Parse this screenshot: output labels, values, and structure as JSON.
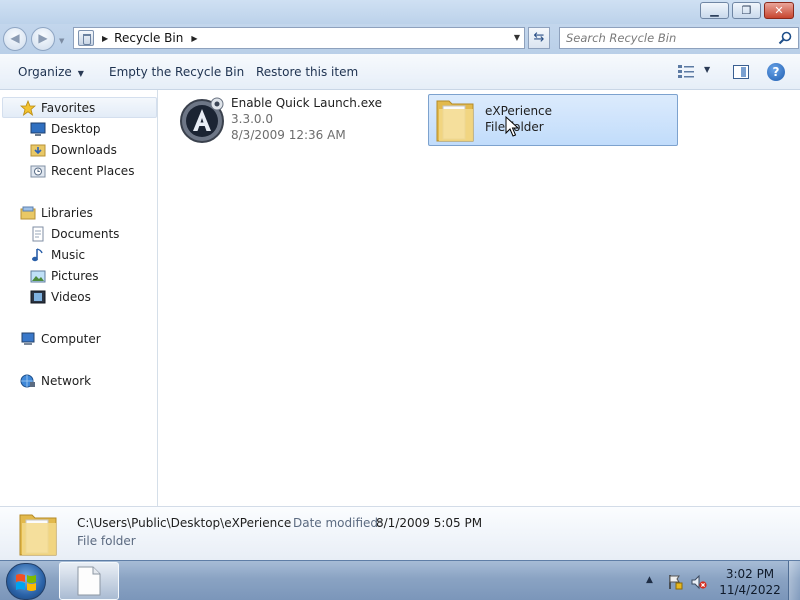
{
  "window": {
    "controls": {
      "minimize": "▁",
      "maximize": "❐",
      "close": "✕"
    }
  },
  "address": {
    "back": "◀",
    "forward": "▶",
    "crumb_sep": "▶",
    "crumb": "Recycle Bin",
    "trail_sep": "▶",
    "dropdown": "▼",
    "refresh": "⇆",
    "search_placeholder": "Search Recycle Bin"
  },
  "toolbar": {
    "organize": "Organize",
    "organize_dd": "▼",
    "empty": "Empty the Recycle Bin",
    "restore": "Restore this item",
    "view_dd": "▼",
    "help": "?"
  },
  "nav": {
    "favorites": {
      "label": "Favorites",
      "items": [
        "Desktop",
        "Downloads",
        "Recent Places"
      ]
    },
    "libraries": {
      "label": "Libraries",
      "items": [
        "Documents",
        "Music",
        "Pictures",
        "Videos"
      ]
    },
    "computer": "Computer",
    "network": "Network"
  },
  "items": [
    {
      "name": "Enable Quick Launch.exe",
      "version": "3.3.0.0",
      "date": "8/3/2009 12:36 AM",
      "icon": "app-icon"
    },
    {
      "name": "eXPerience",
      "type": "File folder",
      "icon": "folder-icon",
      "selected": true
    }
  ],
  "details": {
    "path": "C:\\Users\\Public\\Desktop\\eXPerience",
    "date_label": "Date modified:",
    "date_value": "8/1/2009 5:05 PM",
    "type": "File folder"
  },
  "taskbar": {
    "tray_chevron": "▲",
    "time": "3:02 PM",
    "date": "11/4/2022"
  },
  "colors": {
    "selection": "#c1dcfb",
    "selection_border": "#7da2ce",
    "taskbar": "#8aa3c3",
    "chrome": "#bcd2ea"
  }
}
